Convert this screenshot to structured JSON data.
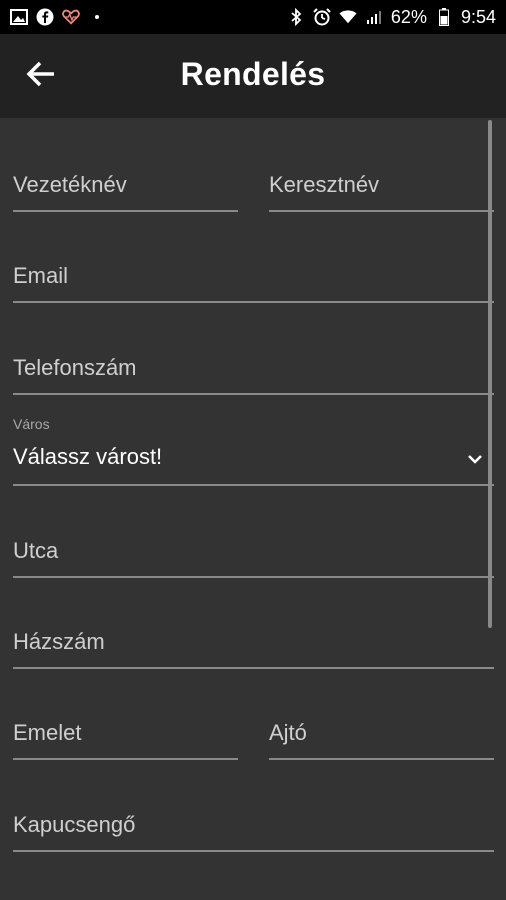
{
  "status_bar": {
    "battery": "62%",
    "time": "9:54",
    "left_icons": [
      "image-icon",
      "facebook-icon",
      "heart-icon",
      "dot-icon"
    ],
    "right_icons": [
      "bluetooth-icon",
      "alarm-icon",
      "wifi-icon",
      "signal-icon",
      "battery-icon"
    ]
  },
  "header": {
    "title": "Rendelés",
    "back_icon": "arrow-left-icon"
  },
  "form": {
    "last_name_placeholder": "Vezetéknév",
    "first_name_placeholder": "Keresztnév",
    "email_placeholder": "Email",
    "phone_placeholder": "Telefonszám",
    "city_label": "Város",
    "city_value": "Válassz várost!",
    "street_placeholder": "Utca",
    "house_number_placeholder": "Házszám",
    "floor_placeholder": "Emelet",
    "door_placeholder": "Ajtó",
    "doorbell_placeholder": "Kapucsengő"
  },
  "colors": {
    "background": "#333333",
    "appbar": "#222222",
    "statusbar": "#000000",
    "underline": "#8a8a8a"
  }
}
